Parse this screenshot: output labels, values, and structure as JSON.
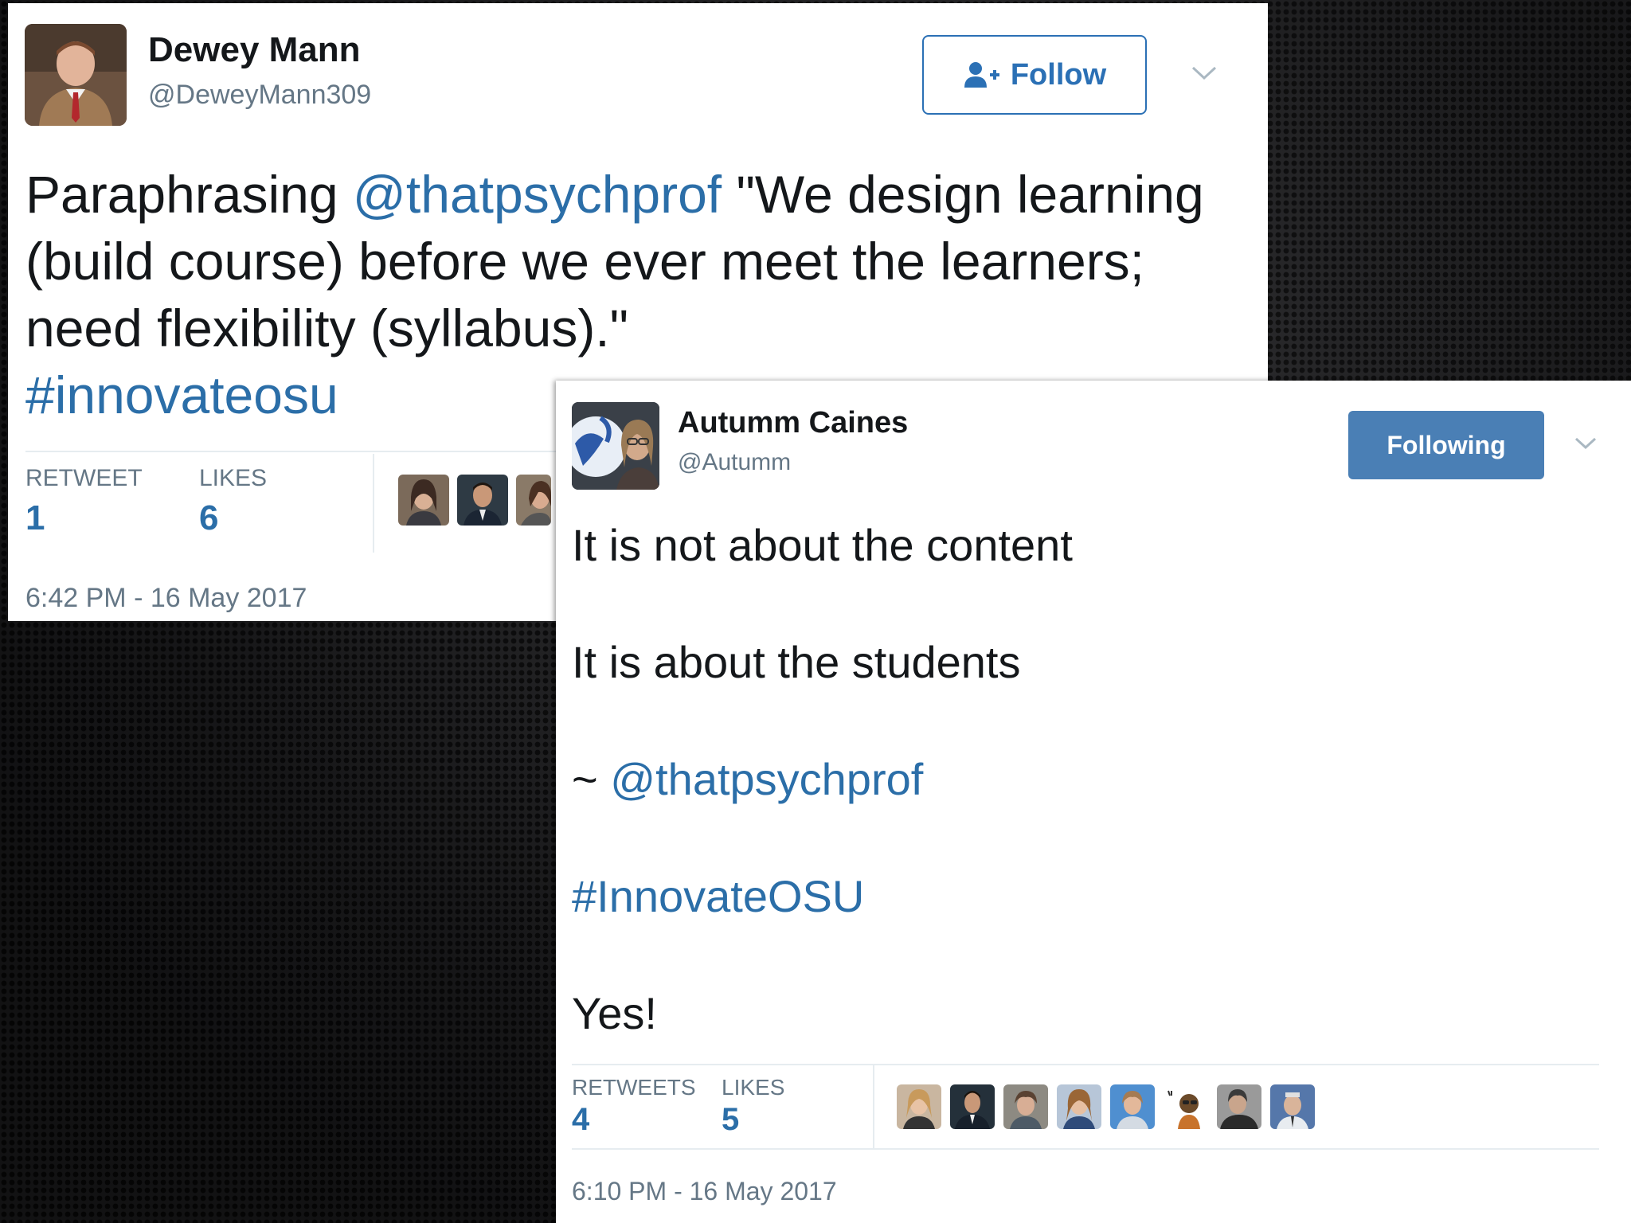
{
  "tweets": [
    {
      "name": "Dewey Mann",
      "handle": "@DeweyMann309",
      "follow_label": "Follow",
      "text": {
        "prefix": "Paraphrasing ",
        "mention": "@thatpsychprof",
        "body": " \"We design learning (build course) before we ever meet the learners; need flexibility (syllabus).\"",
        "hashtag": "#innovateosu"
      },
      "stats": {
        "retweets_label": "RETWEET",
        "retweets": "1",
        "likes_label": "LIKES",
        "likes": "6"
      },
      "timestamp": "6:42 PM - 16 May 2017"
    },
    {
      "name": "Autumm Caines",
      "handle": "@Autumm",
      "following_label": "Following",
      "lines": {
        "line1": "It is not about the content",
        "line2": "It is about the students",
        "line3_prefix": "~ ",
        "line3_mention": "@thatpsychprof",
        "hashtag": "#InnovateOSU",
        "closing": "Yes!"
      },
      "stats": {
        "retweets_label": "RETWEETS",
        "retweets": "4",
        "likes_label": "LIKES",
        "likes": "5"
      },
      "timestamp": "6:10 PM - 16 May 2017"
    }
  ],
  "colors": {
    "link": "#2b6ea8",
    "follow_border": "#2b70b5",
    "following_bg": "#4a7fb5",
    "muted": "#657786"
  },
  "icons": [
    "add-user-icon",
    "chevron-down-icon"
  ]
}
